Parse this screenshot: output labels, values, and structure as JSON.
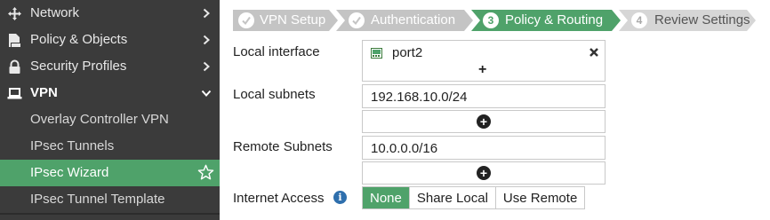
{
  "sidebar": {
    "items": [
      {
        "label": "Network",
        "icon": "network-icon"
      },
      {
        "label": "Policy & Objects",
        "icon": "policy-icon"
      },
      {
        "label": "Security Profiles",
        "icon": "lock-icon"
      },
      {
        "label": "VPN",
        "icon": "laptop-icon"
      },
      {
        "label": "Overlay Controller VPN"
      },
      {
        "label": "IPsec Tunnels"
      },
      {
        "label": "IPsec Wizard",
        "icon": "star-icon"
      },
      {
        "label": "IPsec Tunnel Template"
      }
    ]
  },
  "wizard": {
    "steps": [
      {
        "label": "VPN Setup",
        "state": "done"
      },
      {
        "label": "Authentication",
        "state": "done"
      },
      {
        "number": "3",
        "label": "Policy & Routing",
        "state": "current"
      },
      {
        "number": "4",
        "label": "Review Settings",
        "state": "todo"
      }
    ]
  },
  "form": {
    "local_interface": {
      "label": "Local interface",
      "value": "port2",
      "add": "+"
    },
    "local_subnets": {
      "label": "Local subnets",
      "value": "192.168.10.0/24",
      "add": "+"
    },
    "remote_subnets": {
      "label": "Remote Subnets",
      "value": "10.0.0.0/16",
      "add": "+"
    },
    "internet_access": {
      "label": "Internet Access",
      "options": [
        "None",
        "Share Local",
        "Use Remote"
      ],
      "selected": "None"
    }
  },
  "colors": {
    "sidebar_bg": "#3b3b3b",
    "accent_green": "#4fa26a",
    "step_done": "#c4c4c4",
    "step_todo": "#d6d6d6",
    "info_blue": "#2e6fad"
  }
}
